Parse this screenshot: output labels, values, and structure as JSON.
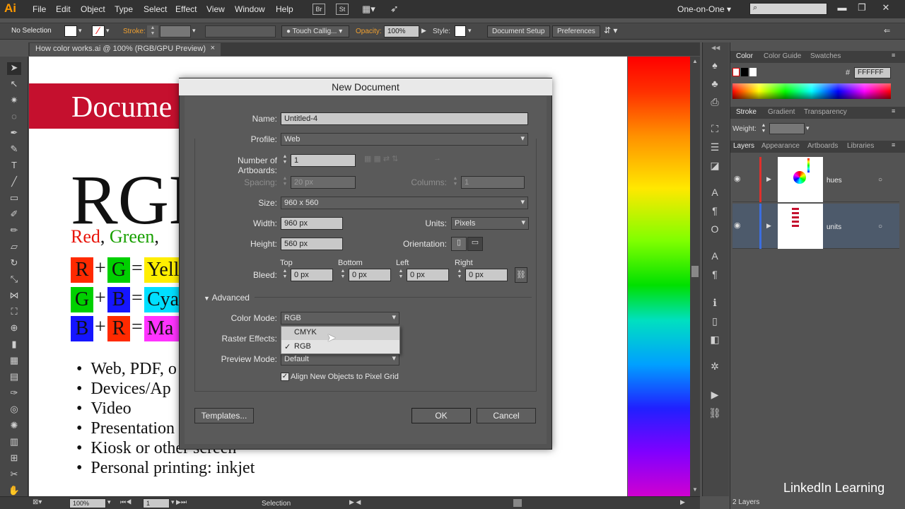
{
  "menubar": {
    "logo": "Ai",
    "items": [
      "File",
      "Edit",
      "Object",
      "Type",
      "Select",
      "Effect",
      "View",
      "Window",
      "Help"
    ],
    "br": "Br",
    "st": "St",
    "workspace": "One-on-One"
  },
  "control": {
    "selection": "No Selection",
    "stroke_label": "Stroke:",
    "brush": "Touch Callig...",
    "opacity_label": "Opacity:",
    "opacity": "100%",
    "style_label": "Style:",
    "doc_setup": "Document Setup",
    "preferences": "Preferences"
  },
  "tab": {
    "title": "How color works.ai @ 100% (RGB/GPU Preview)",
    "close": "×"
  },
  "artboard": {
    "header": "Docume",
    "rgb": "RGB",
    "sub_red": "Red",
    "sub_comma1": ", ",
    "sub_green": "Green",
    "sub_comma2": ",",
    "rows": [
      {
        "a": "R",
        "a_color": "#ff2a00",
        "b": "G",
        "b_color": "#00d000",
        "c": "Yell",
        "c_color": "#ffee00"
      },
      {
        "a": "G",
        "a_color": "#00d000",
        "b": "B",
        "b_color": "#1515ff",
        "c": "Cya",
        "c_color": "#00dfff"
      },
      {
        "a": "B",
        "a_color": "#1515ff",
        "b": "R",
        "b_color": "#ff2a00",
        "c": "Ma",
        "c_color": "#ff33ff"
      }
    ],
    "plus": "+",
    "equals": "=",
    "bullets": [
      "Web, PDF, o",
      "Devices/Ap",
      "Video",
      "Presentation",
      "Kiosk or other screen",
      "Personal printing: inkjet"
    ]
  },
  "panels": {
    "color_tabs": [
      "Color",
      "Color Guide",
      "Swatches"
    ],
    "hex_label": "#",
    "hex": "FFFFFF",
    "stroke_tabs": [
      "Stroke",
      "Gradient",
      "Transparency"
    ],
    "weight_label": "Weight:",
    "layer_tabs": [
      "Layers",
      "Appearance",
      "Artboards",
      "Libraries"
    ],
    "layers": [
      {
        "name": "hues",
        "color": "#e0302c"
      },
      {
        "name": "units",
        "color": "#3c6ee0"
      }
    ],
    "layer_count": "2 Layers"
  },
  "dialog": {
    "title": "New Document",
    "name_label": "Name:",
    "name": "Untitled-4",
    "profile_label": "Profile:",
    "profile": "Web",
    "artboards_label": "Number of Artboards:",
    "artboards": "1",
    "spacing_label": "Spacing:",
    "spacing": "20 px",
    "columns_label": "Columns:",
    "columns": "1",
    "size_label": "Size:",
    "size": "960 x 560",
    "width_label": "Width:",
    "width": "960 px",
    "units_label": "Units:",
    "units": "Pixels",
    "height_label": "Height:",
    "height": "560 px",
    "orientation_label": "Orientation:",
    "bleed_label": "Bleed:",
    "bleed_top_label": "Top",
    "bleed_bottom_label": "Bottom",
    "bleed_left_label": "Left",
    "bleed_right_label": "Right",
    "bleed_top": "0 px",
    "bleed_bottom": "0 px",
    "bleed_left": "0 px",
    "bleed_right": "0 px",
    "advanced_label": "Advanced",
    "color_mode_label": "Color Mode:",
    "color_mode": "RGB",
    "raster_label": "Raster Effects:",
    "preview_label": "Preview Mode:",
    "preview": "Default",
    "align_label": "Align New Objects to Pixel Grid",
    "templates": "Templates...",
    "ok": "OK",
    "cancel": "Cancel",
    "dropdown_options": [
      "CMYK",
      "RGB"
    ],
    "dropdown_checked": "✓"
  },
  "status": {
    "zoom": "100%",
    "artboard_num": "1",
    "tool": "Selection"
  },
  "watermark": "LinkedIn Learning"
}
